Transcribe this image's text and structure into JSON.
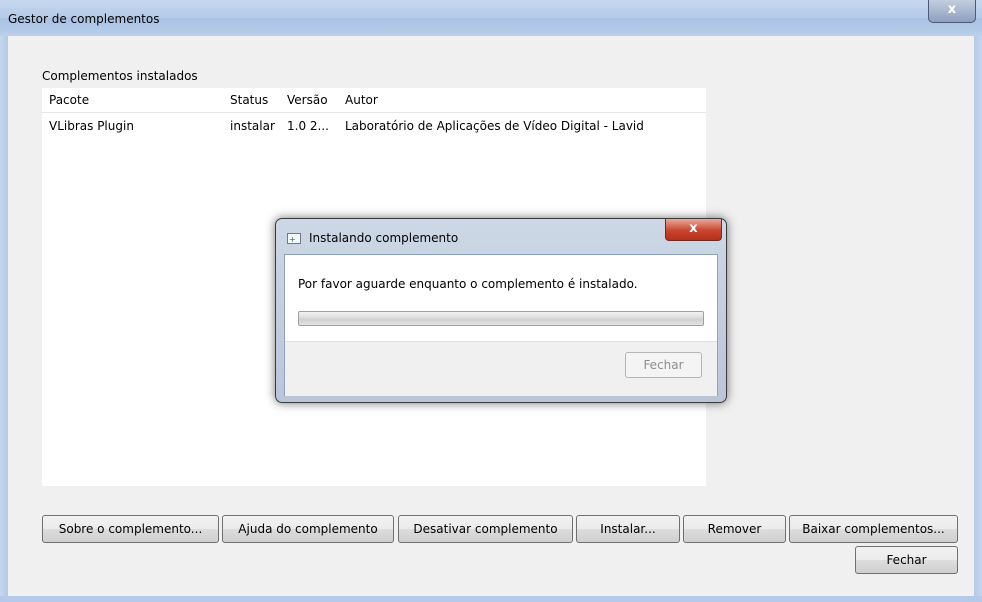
{
  "window": {
    "title": "Gestor de complementos",
    "close_glyph": "x"
  },
  "installed": {
    "label": "Complementos instalados",
    "columns": [
      "Pacote",
      "Status",
      "Versão",
      "Autor"
    ],
    "rows": [
      {
        "package": "VLibras Plugin",
        "status": "instalar",
        "version": "1.0 2...",
        "author": "Laboratório de Aplicações de Vídeo Digital - Lavid"
      }
    ]
  },
  "buttons": {
    "about": "Sobre o complemento...",
    "help": "Ajuda do complemento",
    "disable": "Desativar complemento",
    "install": "Instalar...",
    "remove": "Remover",
    "download": "Baixar complementos...",
    "close": "Fechar"
  },
  "dialog": {
    "title": "Instalando complemento",
    "close_glyph": "x",
    "message": "Por favor aguarde enquanto o complemento é instalado.",
    "progress": 0,
    "close_label": "Fechar"
  }
}
